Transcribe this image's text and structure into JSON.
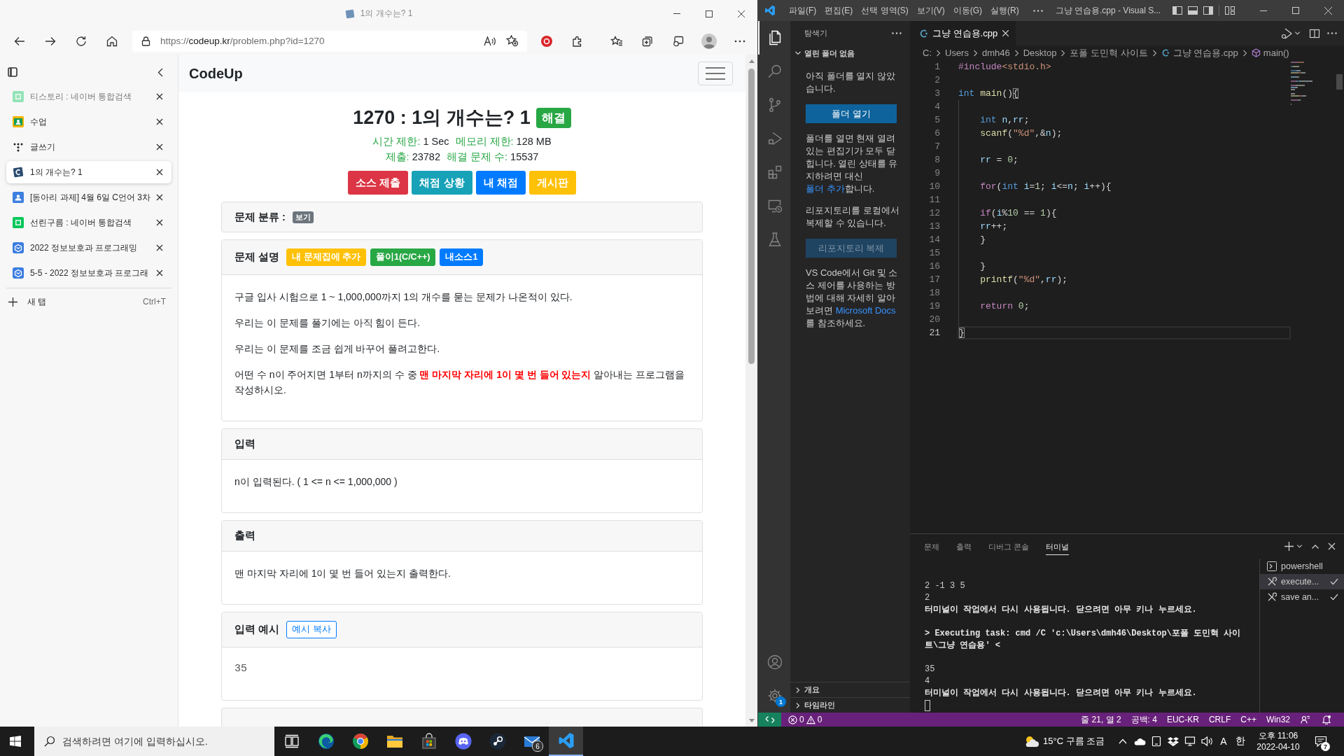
{
  "browser": {
    "title": "1의 개수는? 1",
    "url": {
      "scheme": "https://",
      "host": "codeup.kr",
      "path": "/problem.php?id=1270"
    },
    "tabs": [
      {
        "title": "티스토리 : 네이버 통합검색",
        "kind": "naver",
        "sleeping": true,
        "selected": false
      },
      {
        "title": "수업",
        "kind": "classroom",
        "sleeping": false,
        "selected": false
      },
      {
        "title": "글쓰기",
        "kind": "dots",
        "sleeping": false,
        "selected": false
      },
      {
        "title": "1의 개수는? 1",
        "kind": "codeup",
        "sleeping": false,
        "selected": true
      },
      {
        "title": "[동아리 과제] 4월 6일 C언어 3차",
        "kind": "person",
        "sleeping": false,
        "selected": false
      },
      {
        "title": "선린구름 : 네이버 통합검색",
        "kind": "naver",
        "sleeping": false,
        "selected": false
      },
      {
        "title": "2022 정보보호과 프로그래밍",
        "kind": "hat",
        "sleeping": false,
        "selected": false
      },
      {
        "title": "5-5 - 2022 정보보호과 프로그래",
        "kind": "hat",
        "sleeping": false,
        "selected": false
      }
    ],
    "new_tab": {
      "label": "새 탭",
      "shortcut": "Ctrl+T"
    }
  },
  "page": {
    "brand": "CodeUp",
    "title": "1270 : 1의 개수는? 1",
    "badge": "해결",
    "limits": [
      {
        "label": "시간 제한:",
        "value": "1 Sec"
      },
      {
        "label": "메모리 제한:",
        "value": "128 MB"
      }
    ],
    "stats": [
      {
        "label": "제출:",
        "value": "23782"
      },
      {
        "label": "해결 문제 수:",
        "value": "15537"
      }
    ],
    "actions": [
      {
        "label": "소스 제출",
        "color": "#dc3545"
      },
      {
        "label": "채점 상황",
        "color": "#17a2b8"
      },
      {
        "label": "내 채점",
        "color": "#007bff"
      },
      {
        "label": "게시판",
        "color": "#ffc107"
      }
    ],
    "cards": [
      {
        "kind": "header-only",
        "title": "문제 분류 :",
        "tag": "보기"
      },
      {
        "kind": "text",
        "title": "문제 설명",
        "buttons": [
          {
            "label": "내 문제집에 추가",
            "color": "#ffc107",
            "outline": false
          },
          {
            "label": "풀이1(C/C++)",
            "color": "#28a745",
            "outline": false
          },
          {
            "label": "내소스1",
            "color": "#007bff",
            "outline": false
          }
        ],
        "paragraphs": [
          "구글 입사 시험으로 1 ~ 1,000,000까지 1의 개수를 묻는 문제가 나온적이 있다.",
          "우리는 이 문제를 풀기에는 아직 힘이 든다.",
          "우리는 이 문제를 조금 쉽게 바꾸어 풀려고한다.",
          "어떤 수 n이 주어지면 1부터 n까지의 수 중 **맨 마지막 자리에 1이 몇 번 들어 있는지** 알아내는 프로그램을 작성하시오."
        ]
      },
      {
        "kind": "text",
        "title": "입력",
        "paragraphs": [
          "n이 입력된다. ( 1 <= n <= 1,000,000 )"
        ]
      },
      {
        "kind": "text",
        "title": "출력",
        "paragraphs": [
          "맨 마지막 자리에 1이 몇 번 들어 있는지 출력한다."
        ]
      },
      {
        "kind": "sample",
        "title": "입력 예시",
        "buttons": [
          {
            "label": "예시 복사",
            "color": "#007bff",
            "outline": true
          }
        ],
        "sample": "35"
      },
      {
        "kind": "cut"
      }
    ]
  },
  "vscode": {
    "menu": [
      "파일(F)",
      "편집(E)",
      "선택 영역(S)",
      "보기(V)",
      "이동(G)",
      "실행(R)"
    ],
    "title": "그냥 연습용.cpp - Visual S...",
    "activity": [
      {
        "kind": "files",
        "selected": true
      },
      {
        "kind": "search",
        "selected": false
      },
      {
        "kind": "source-control",
        "selected": false
      },
      {
        "kind": "run-debug",
        "selected": false
      },
      {
        "kind": "extensions",
        "selected": false
      },
      {
        "kind": "remote",
        "selected": false
      },
      {
        "kind": "testing",
        "selected": false
      }
    ],
    "manage_badge": "1",
    "sidebar": {
      "title": "탐색기",
      "sections": [
        {
          "label": "열린 폴더 없음",
          "expanded": true,
          "blocks": [
            {
              "kind": "text",
              "text": "아직 폴더를 열지 않았습니다."
            },
            {
              "kind": "button",
              "label": "폴더 열기",
              "disabled": false
            },
            {
              "kind": "text",
              "text": "폴더를 열면 현재 열려 있는 편집기가 모두 닫힙니다. 열린 상태를 유지하려면 대신 ",
              "link": "폴더 추가",
              "after": "합니다."
            },
            {
              "kind": "text",
              "text": "리포지토리를 로컬에서 복제할 수 있습니다."
            },
            {
              "kind": "button",
              "label": "리포지토리 복제",
              "disabled": true
            },
            {
              "kind": "text",
              "text": "VS Code에서 Git 및 소스 제어를 사용하는 방법에 대해 자세히 알아보려면 ",
              "link": "Microsoft Docs",
              "after": "를 참조하세요."
            }
          ]
        },
        {
          "label": "개요",
          "expanded": false
        },
        {
          "label": "타임라인",
          "expanded": false
        }
      ]
    },
    "tabs": [
      {
        "label": "그냥 연습용.cpp",
        "selected": true
      }
    ],
    "breadcrumb": [
      {
        "label": "C:",
        "kind": "folder"
      },
      {
        "label": "Users",
        "kind": "folder"
      },
      {
        "label": "dmh46",
        "kind": "folder"
      },
      {
        "label": "Desktop",
        "kind": "folder"
      },
      {
        "label": "포폴 도민혁 사이트",
        "kind": "folder"
      },
      {
        "label": "그냥 연습용.cpp",
        "kind": "file"
      },
      {
        "label": "main()",
        "kind": "symbol"
      }
    ],
    "code": [
      {
        "number": "1",
        "current": false,
        "tokens": [
          {
            "text": "#include",
            "kind": "pre"
          },
          {
            "text": "<stdio.h>",
            "kind": "str"
          }
        ]
      },
      {
        "number": "2",
        "current": false
      },
      {
        "number": "3",
        "current": false,
        "tokens": [
          {
            "text": "int",
            "kind": "type"
          },
          {
            "text": " main",
            "kind": "fn"
          },
          {
            "text": "()",
            "kind": "plain"
          },
          {
            "text": "{",
            "kind": "match"
          }
        ]
      },
      {
        "number": "4",
        "current": false
      },
      {
        "number": "5",
        "current": false,
        "tokens": [
          {
            "text": "    int",
            "kind": "type"
          },
          {
            "text": " n",
            "kind": "var"
          },
          {
            "text": ",",
            "kind": "plain"
          },
          {
            "text": "rr",
            "kind": "var"
          },
          {
            "text": ";",
            "kind": "plain"
          }
        ]
      },
      {
        "number": "6",
        "current": false,
        "tokens": [
          {
            "text": "    scanf",
            "kind": "fn"
          },
          {
            "text": "(",
            "kind": "plain"
          },
          {
            "text": "\"%d\"",
            "kind": "str"
          },
          {
            "text": ",&",
            "kind": "plain"
          },
          {
            "text": "n",
            "kind": "var"
          },
          {
            "text": ");",
            "kind": "plain"
          }
        ]
      },
      {
        "number": "7",
        "current": false
      },
      {
        "number": "8",
        "current": false,
        "tokens": [
          {
            "text": "    rr",
            "kind": "var"
          },
          {
            "text": " = ",
            "kind": "plain"
          },
          {
            "text": "0",
            "kind": "num"
          },
          {
            "text": ";",
            "kind": "plain"
          }
        ]
      },
      {
        "number": "9",
        "current": false
      },
      {
        "number": "10",
        "current": false,
        "tokens": [
          {
            "text": "    for",
            "kind": "ctrl"
          },
          {
            "text": "(",
            "kind": "plain"
          },
          {
            "text": "int",
            "kind": "type"
          },
          {
            "text": " i",
            "kind": "var"
          },
          {
            "text": "=",
            "kind": "plain"
          },
          {
            "text": "1",
            "kind": "num"
          },
          {
            "text": "; ",
            "kind": "plain"
          },
          {
            "text": "i",
            "kind": "var"
          },
          {
            "text": "<=",
            "kind": "plain"
          },
          {
            "text": "n",
            "kind": "var"
          },
          {
            "text": "; ",
            "kind": "plain"
          },
          {
            "text": "i",
            "kind": "var"
          },
          {
            "text": "++){",
            "kind": "plain"
          }
        ]
      },
      {
        "number": "11",
        "current": false
      },
      {
        "number": "12",
        "current": false,
        "tokens": [
          {
            "text": "    if",
            "kind": "ctrl"
          },
          {
            "text": "(",
            "kind": "plain"
          },
          {
            "text": "i",
            "kind": "var"
          },
          {
            "text": "%",
            "kind": "plain"
          },
          {
            "text": "10",
            "kind": "num"
          },
          {
            "text": " == ",
            "kind": "plain"
          },
          {
            "text": "1",
            "kind": "num"
          },
          {
            "text": "){",
            "kind": "plain"
          }
        ]
      },
      {
        "number": "13",
        "current": false,
        "tokens": [
          {
            "text": "    rr",
            "kind": "var"
          },
          {
            "text": "++;",
            "kind": "plain"
          }
        ]
      },
      {
        "number": "14",
        "current": false,
        "tokens": [
          {
            "text": "    }",
            "kind": "plain"
          }
        ]
      },
      {
        "number": "15",
        "current": false
      },
      {
        "number": "16",
        "current": false,
        "tokens": [
          {
            "text": "    }",
            "kind": "plain"
          }
        ]
      },
      {
        "number": "17",
        "current": false,
        "tokens": [
          {
            "text": "    printf",
            "kind": "fn"
          },
          {
            "text": "(",
            "kind": "plain"
          },
          {
            "text": "\"%d\"",
            "kind": "str"
          },
          {
            "text": ",",
            "kind": "plain"
          },
          {
            "text": "rr",
            "kind": "var"
          },
          {
            "text": ");",
            "kind": "plain"
          }
        ]
      },
      {
        "number": "18",
        "current": false
      },
      {
        "number": "19",
        "current": false,
        "tokens": [
          {
            "text": "    return",
            "kind": "ctrl"
          },
          {
            "text": " 0",
            "kind": "num"
          },
          {
            "text": ";",
            "kind": "plain"
          }
        ]
      },
      {
        "number": "20",
        "current": false
      },
      {
        "number": "21",
        "current": true,
        "tokens": [
          {
            "text": "}",
            "kind": "match"
          }
        ]
      }
    ],
    "panel": {
      "tabs": [
        {
          "label": "문제",
          "selected": false
        },
        {
          "label": "출력",
          "selected": false
        },
        {
          "label": "디버그 콘솔",
          "selected": false
        },
        {
          "label": "터미널",
          "selected": true
        }
      ],
      "output": [
        [
          {
            "text": "2 -1 3 5",
            "kind": "output"
          },
          {
            "text": "2",
            "kind": "output"
          },
          {
            "text": "터미널이 작업에서 다시 사용됩니다. 닫으려면 아무 키나 누르세요.",
            "kind": "notice"
          }
        ],
        [
          {
            "text": "> Executing task: cmd /C 'c:\\Users\\dmh46\\Desktop\\포폴 도민혁 사이",
            "kind": "command"
          },
          {
            "text": "트\\그냥 연습용' <",
            "kind": "command"
          }
        ],
        [
          {
            "text": "35",
            "kind": "output"
          },
          {
            "text": "4",
            "kind": "output"
          },
          {
            "text": "터미널이 작업에서 다시 사용됩니다. 닫으려면 아무 키나 누르세요.",
            "kind": "notice"
          }
        ]
      ],
      "sessions": [
        {
          "label": "powershell",
          "kind": "shell",
          "selected": false,
          "done": false
        },
        {
          "label": "execute...",
          "kind": "task",
          "selected": true,
          "done": true
        },
        {
          "label": "save an...",
          "kind": "task",
          "selected": false,
          "done": true
        }
      ]
    },
    "status": {
      "errors": "0",
      "warnings": "0",
      "items": [
        "줄 21, 열 2",
        "공백: 4",
        "EUC-KR",
        "CRLF",
        "C++",
        "Win32"
      ]
    }
  },
  "taskbar": {
    "search": {
      "placeholder": "검색하려면 여기에 입력하십시오."
    },
    "apps": [
      {
        "kind": "task-view",
        "selected": false
      },
      {
        "kind": "edge",
        "selected": false
      },
      {
        "kind": "chrome",
        "selected": false
      },
      {
        "kind": "files",
        "selected": false
      },
      {
        "kind": "store",
        "selected": false
      },
      {
        "kind": "discord",
        "selected": false
      },
      {
        "kind": "steam",
        "selected": false
      },
      {
        "kind": "mail",
        "selected": false,
        "badge": "6"
      },
      {
        "kind": "vscode",
        "selected": true
      }
    ],
    "weather": "15°C 구름 조금",
    "ime": [
      "A",
      "한"
    ],
    "time": "오후 11:06",
    "date": "2022-04-10",
    "notifications": "7"
  }
}
